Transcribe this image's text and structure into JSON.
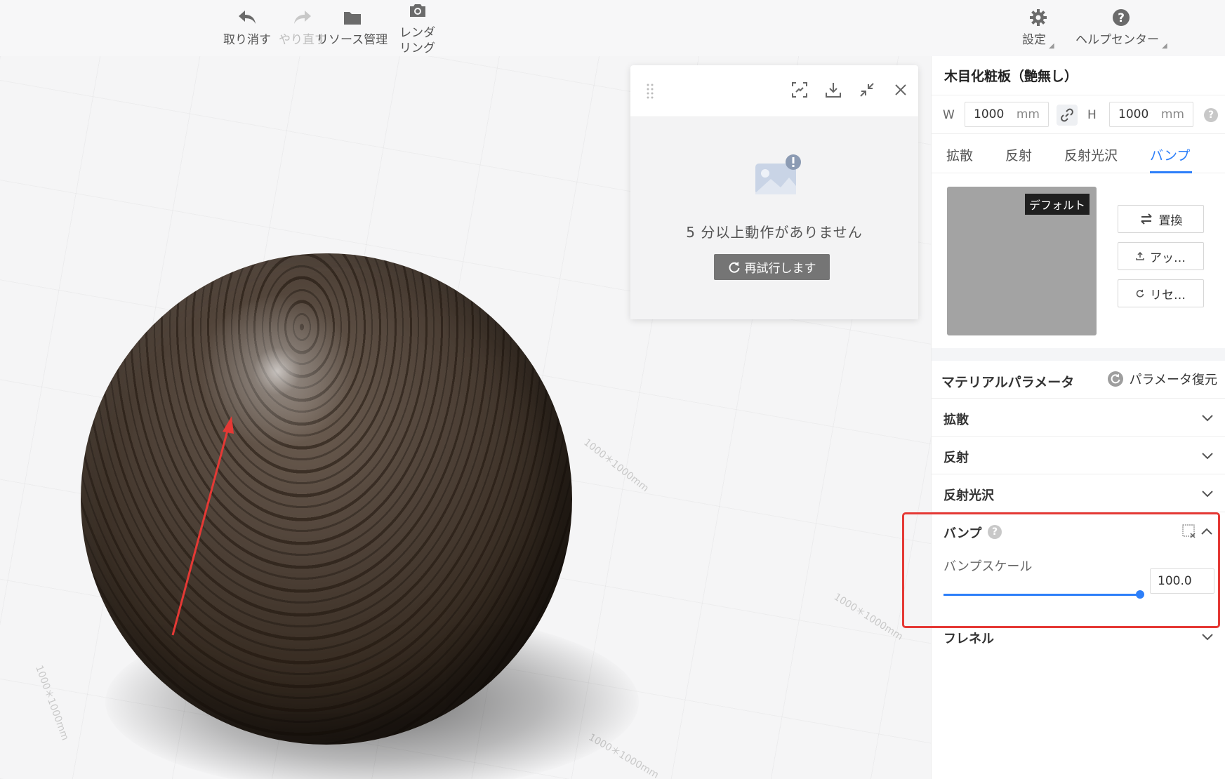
{
  "toolbar": {
    "undo": "取り消す",
    "redo": "やり直す",
    "resources": "リソース管理",
    "render_line1": "レンダ",
    "render_line2": "リング",
    "settings": "設定",
    "help": "ヘルプセンター"
  },
  "viewport": {
    "grid_label": "1000＊1000mm"
  },
  "dialog": {
    "message": "5 分以上動作がありません",
    "retry_label": "再試行します"
  },
  "panel": {
    "material_name": "木目化粧板（艶無し）",
    "width_label": "W",
    "width_value": "1000",
    "height_label": "H",
    "height_value": "1000",
    "unit": "mm",
    "tabs": [
      {
        "label": "拡散"
      },
      {
        "label": "反射"
      },
      {
        "label": "反射光沢"
      },
      {
        "label": "バンプ"
      }
    ],
    "active_tab": "バンプ",
    "thumbnail_tag": "デフォルト",
    "replace_button": "置換",
    "upload_button": "アッ…",
    "reset_button": "リセ…",
    "params_title": "マテリアルパラメータ",
    "restore_button": "パラメータ復元",
    "sections": {
      "diffuse": "拡散",
      "reflection": "反射",
      "gloss": "反射光沢",
      "bump": "バンプ",
      "fresnel": "フレネル"
    },
    "bump_scale_label": "バンプスケール",
    "bump_scale_value": "100.0"
  },
  "colors": {
    "accent": "#2d7ff9",
    "highlight": "#e53935",
    "retry_bg": "#757575"
  }
}
